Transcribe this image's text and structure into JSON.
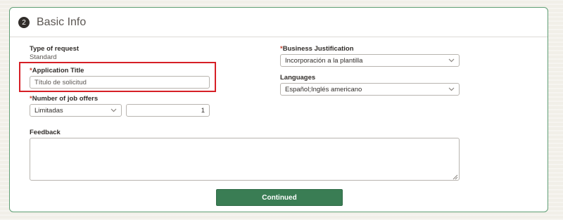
{
  "section": {
    "step_number": "2",
    "title": "Basic Info"
  },
  "type_of_request": {
    "label": "Type of request",
    "value": "Standard"
  },
  "application_title": {
    "required_mark": "*",
    "label": "Application Title",
    "placeholder": "Título de solicitud",
    "value": ""
  },
  "number_of_job_offers": {
    "required_mark": "*",
    "label": "Number of job offers",
    "select_value": "Limitadas",
    "count_value": "1"
  },
  "business_justification": {
    "required_mark": "*",
    "label": "Business Justification",
    "value": "Incorporación a la plantilla"
  },
  "languages": {
    "label": "Languages",
    "value": "Español;Inglés americano"
  },
  "feedback": {
    "label": "Feedback",
    "value": ""
  },
  "actions": {
    "continue_label": "Continued"
  },
  "colors": {
    "card_border": "#5e9e74",
    "button": "#3a7d54",
    "required": "#c74634",
    "highlight": "#d61f26",
    "page_background": "#f1efe8"
  },
  "icons": {
    "dropdown": "chevron-down-icon",
    "resize": "resize-grip-icon"
  }
}
